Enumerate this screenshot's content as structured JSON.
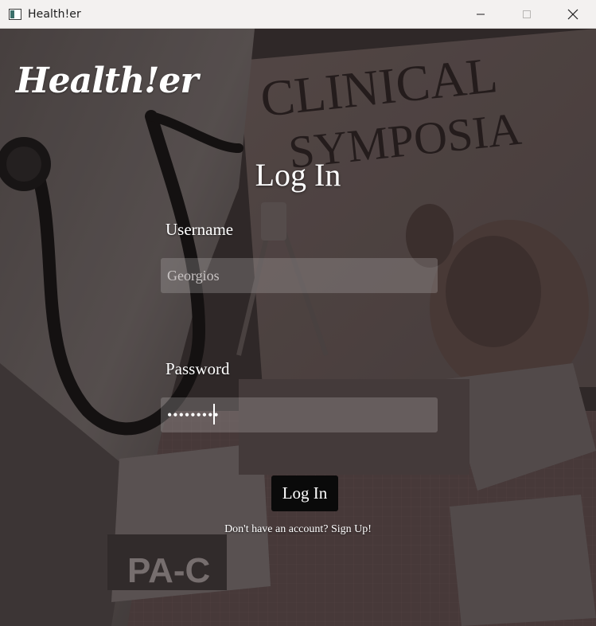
{
  "window": {
    "title": "Health!er",
    "controls": [
      "minimize-icon",
      "maximize-icon",
      "close-icon"
    ]
  },
  "app": {
    "logo": "Health!er"
  },
  "background": {
    "poster_text_line1": "CLINICAL",
    "poster_text_line2": "SYMPOSIA",
    "badge_text": "PA-C"
  },
  "login": {
    "heading": "Log In",
    "username_label": "Username",
    "username_placeholder": "Georgios",
    "password_label": "Password",
    "password_value": "•••••••••",
    "submit_label": "Log In",
    "signup_text": "Don't have an account? Sign Up!"
  },
  "colors": {
    "accent": "#ffffff",
    "button_bg": "#0a0a0a",
    "field_bg": "#8a8585"
  }
}
